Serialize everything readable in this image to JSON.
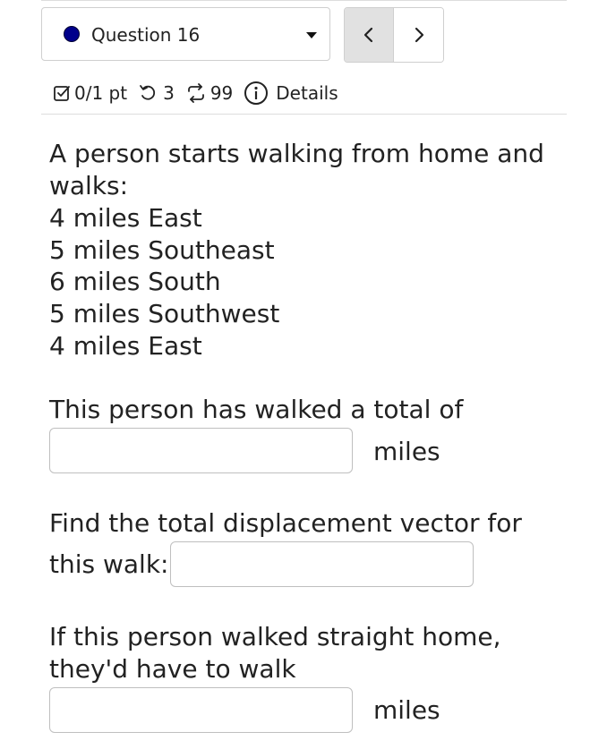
{
  "question_selector": {
    "label": "Question 16",
    "status_color": "#00008b"
  },
  "navigation": {
    "prev_icon": "chevron-left-icon",
    "next_icon": "chevron-right-icon"
  },
  "info_bar": {
    "score": "0/1 pt",
    "retries": "3",
    "attempts": "99",
    "details": "Details"
  },
  "question": {
    "intro": "A person starts walking from home and walks:",
    "legs": [
      "4 miles East",
      "5 miles Southeast",
      "6 miles South",
      "5 miles Southwest",
      "4 miles East"
    ],
    "part1_prompt": "This person has walked a total of",
    "part1_unit": "miles",
    "part1_value": "",
    "part2_prompt_line1": "Find the total displacement vector for",
    "part2_prompt_line2": "this walk:",
    "part2_value": "",
    "part3_prompt_line1": "If this person walked straight home,",
    "part3_prompt_line2": "they'd have to walk",
    "part3_unit": "miles",
    "part3_value": ""
  }
}
